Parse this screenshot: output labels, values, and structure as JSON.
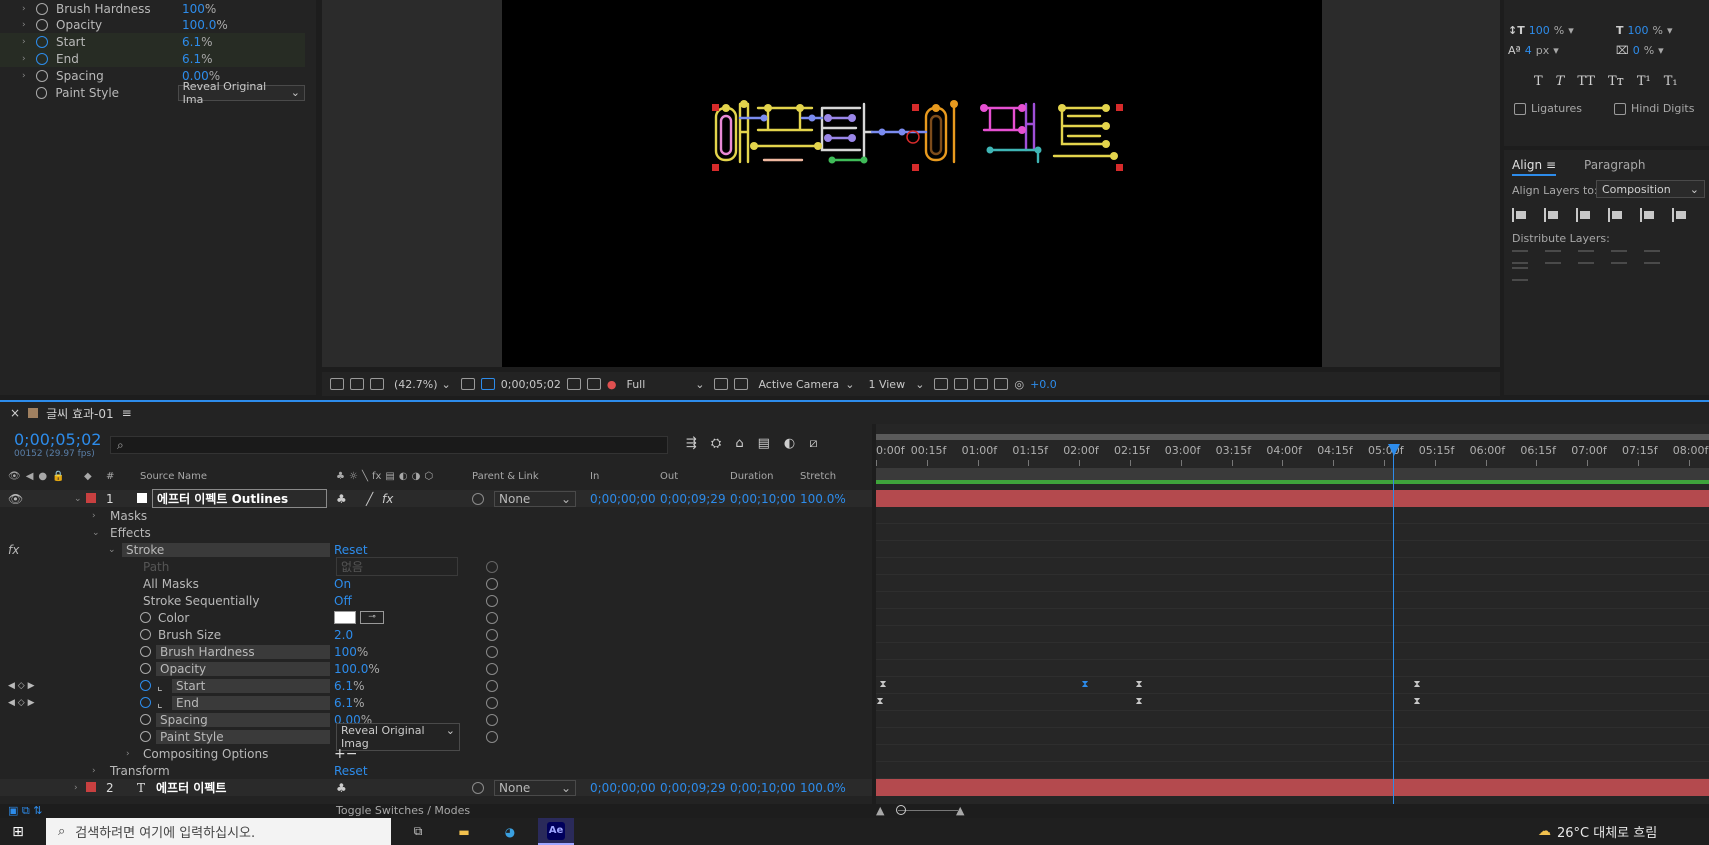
{
  "effect_controls": {
    "rows": [
      {
        "label": "Brush Hardness",
        "value": "100",
        "unit": "%"
      },
      {
        "label": "Opacity",
        "value": "100.0",
        "unit": "%"
      },
      {
        "label": "Start",
        "value": "6.1",
        "unit": "%"
      },
      {
        "label": "End",
        "value": "6.1",
        "unit": "%"
      },
      {
        "label": "Spacing",
        "value": "0.00",
        "unit": "%"
      },
      {
        "label": "Paint Style",
        "value": "Reveal Original Ima"
      }
    ]
  },
  "character_panel": {
    "vert_scale": "100",
    "vert_scale_unit": "%",
    "horiz_scale": "100",
    "horiz_scale_unit": "%",
    "baseline_shift": "4",
    "baseline_unit": "px",
    "tsume": "0",
    "tsume_unit": "%",
    "ligatures_label": "Ligatures",
    "hindi_digits_label": "Hindi Digits",
    "style_buttons": [
      "T",
      "T",
      "TT",
      "Tт",
      "T¹",
      "T₁"
    ]
  },
  "align_panel": {
    "tabs": [
      "Align",
      "Paragraph"
    ],
    "align_to_label": "Align Layers to:",
    "align_to_value": "Composition",
    "distribute_label": "Distribute Layers:"
  },
  "viewer_bar": {
    "zoom": "(42.7%)",
    "timecode": "0;00;05;02",
    "resolution": "Full",
    "camera": "Active Camera",
    "views": "1 View",
    "exposure": "+0.0"
  },
  "timeline": {
    "tab_title": "글씨 효과-01",
    "current_time": "0;00;05;02",
    "frame_info": "00152 (29.97 fps)",
    "search_placeholder": "",
    "columns": {
      "source_name": "Source Name",
      "parent": "Parent & Link",
      "in": "In",
      "out": "Out",
      "duration": "Duration",
      "stretch": "Stretch"
    },
    "ruler": [
      "0:00f",
      "00:15f",
      "01:00f",
      "01:15f",
      "02:00f",
      "02:15f",
      "03:00f",
      "03:15f",
      "04:00f",
      "04:15f",
      "05:00f",
      "05:15f",
      "06:00f",
      "06:15f",
      "07:00f",
      "07:15f",
      "08:00f"
    ],
    "layer1": {
      "num": "1",
      "name": "에프터 이펙트  Outlines",
      "parent": "None",
      "in": "0;00;00;00",
      "out": "0;00;09;29",
      "duration": "0;00;10;00",
      "stretch": "100.0%"
    },
    "layer2": {
      "num": "2",
      "name": "에프터 이펙트",
      "parent": "None",
      "in": "0;00;00;00",
      "out": "0;00;09;29",
      "duration": "0;00;10;00",
      "stretch": "100.0%"
    },
    "props": {
      "masks": "Masks",
      "effects": "Effects",
      "stroke": "Stroke",
      "reset": "Reset",
      "path": "Path",
      "path_value": "없음",
      "all_masks": "All Masks",
      "all_masks_val": "On",
      "stroke_seq": "Stroke Sequentially",
      "stroke_seq_val": "Off",
      "color": "Color",
      "brush_size": "Brush Size",
      "brush_size_val": "2.0",
      "brush_hardness": "Brush Hardness",
      "brush_hardness_val": "100",
      "opacity": "Opacity",
      "opacity_val": "100.0",
      "start": "Start",
      "start_val": "6.1",
      "end": "End",
      "end_val": "6.1",
      "spacing": "Spacing",
      "spacing_val": "0.00",
      "paint_style": "Paint Style",
      "paint_style_val": "Reveal Original Imag",
      "compositing": "Compositing Options",
      "compositing_val": "+−",
      "transform": "Transform",
      "transform_reset": "Reset",
      "percent": "%"
    },
    "toggle_label": "Toggle Switches / Modes"
  },
  "taskbar": {
    "search_placeholder": "검색하려면 여기에 입력하십시오.",
    "weather": "26°C  대체로 흐림",
    "ae_label": "Ae"
  },
  "colors": {
    "accent": "#2d8ceb",
    "layer_bar": "#b44a4e",
    "work_area": "#3ea33b"
  }
}
